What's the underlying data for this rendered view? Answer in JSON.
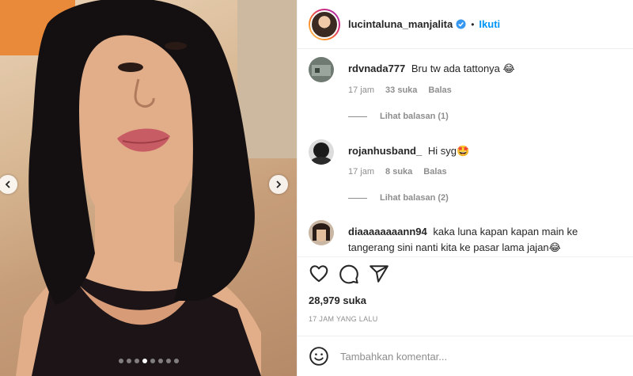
{
  "post": {
    "media_slide_count": 8,
    "media_active_index": 3
  },
  "header": {
    "username": "lucintaluna_manjalita",
    "separator": "•",
    "follow_label": "Ikuti"
  },
  "comments": [
    {
      "username": "rdvnada777",
      "text": "Bru tw ada tattonya",
      "emoji": "😂",
      "time": "17 jam",
      "likes": "33 suka",
      "reply_label": "Balas",
      "view_replies": "Lihat balasan (1)"
    },
    {
      "username": "rojanhusband_",
      "text": "Hi syg",
      "emoji": "🤩",
      "time": "17 jam",
      "likes": "8 suka",
      "reply_label": "Balas",
      "view_replies": "Lihat balasan (2)"
    },
    {
      "username": "diaaaaaaaann94",
      "text": "kaka luna kapan kapan main ke tangerang sini nanti kita ke pasar lama jajan",
      "emoji": "😂"
    }
  ],
  "stats": {
    "likes": "28,979 suka",
    "posted": "17 JAM YANG LALU"
  },
  "add_comment": {
    "placeholder": "Tambahkan komentar..."
  },
  "colors": {
    "accent": "#0095f6",
    "verified": "#3897f0",
    "muted": "#8e8e8e"
  },
  "icons": {
    "like": "heart-icon",
    "comment": "comment-bubble-icon",
    "share": "paper-plane-icon",
    "emoji": "smiley-icon",
    "prev": "chevron-left-icon",
    "next": "chevron-right-icon",
    "verified": "verified-badge-icon"
  }
}
